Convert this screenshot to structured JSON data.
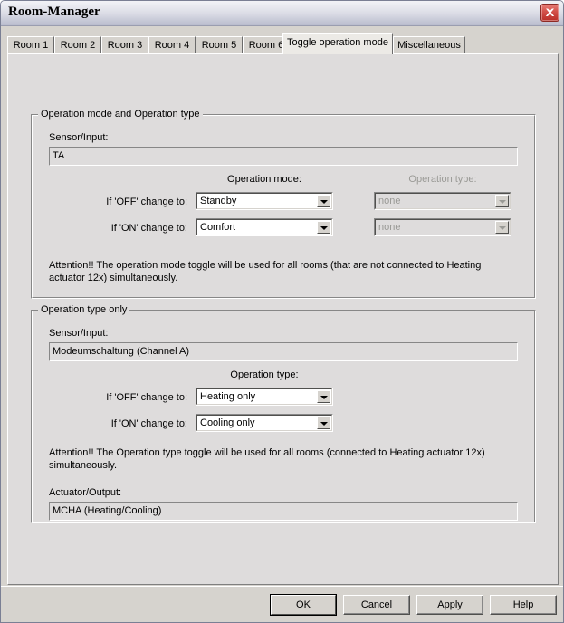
{
  "window": {
    "title": "Room-Manager",
    "close_icon": "close-icon"
  },
  "tabs": [
    {
      "label": "Room 1",
      "selected": false
    },
    {
      "label": "Room 2",
      "selected": false
    },
    {
      "label": "Room 3",
      "selected": false
    },
    {
      "label": "Room 4",
      "selected": false
    },
    {
      "label": "Room 5",
      "selected": false
    },
    {
      "label": "Room 6",
      "selected": false
    },
    {
      "label": "Toggle operation mode",
      "selected": true
    },
    {
      "label": "Miscellaneous",
      "selected": false
    }
  ],
  "group1": {
    "title": "Operation mode and Operation type",
    "sensor_label": "Sensor/Input:",
    "sensor_value": "TA",
    "operation_mode_header": "Operation mode:",
    "operation_type_header": "Operation type:",
    "off_label": "If 'OFF' change to:",
    "on_label": "If 'ON' change to:",
    "off_mode_value": "Standby",
    "on_mode_value": "Comfort",
    "off_type_value": "none",
    "on_type_value": "none",
    "attention": "Attention!! The operation mode toggle will be used for all rooms (that are not connected to Heating actuator 12x) simultaneously."
  },
  "group2": {
    "title": "Operation type only",
    "sensor_label": "Sensor/Input:",
    "sensor_value": "Modeumschaltung  (Channel A)",
    "operation_type_header": "Operation type:",
    "off_label": "If 'OFF' change to:",
    "on_label": "If 'ON' change to:",
    "off_type_value": "Heating only",
    "on_type_value": "Cooling only",
    "attention": "Attention!! The Operation type toggle will be used for all rooms (connected to Heating actuator 12x) simultaneously.",
    "actuator_label": "Actuator/Output:",
    "actuator_value": "MCHA  (Heating/Cooling)"
  },
  "buttons": {
    "ok": "OK",
    "cancel": "Cancel",
    "apply_mnemonic": "A",
    "apply_rest": "pply",
    "help": "Help"
  },
  "colors": {
    "face": "#d6d3ce",
    "page": "#dedcdc",
    "disabled_text": "#9a9a96",
    "close_red": "#b92e27"
  }
}
